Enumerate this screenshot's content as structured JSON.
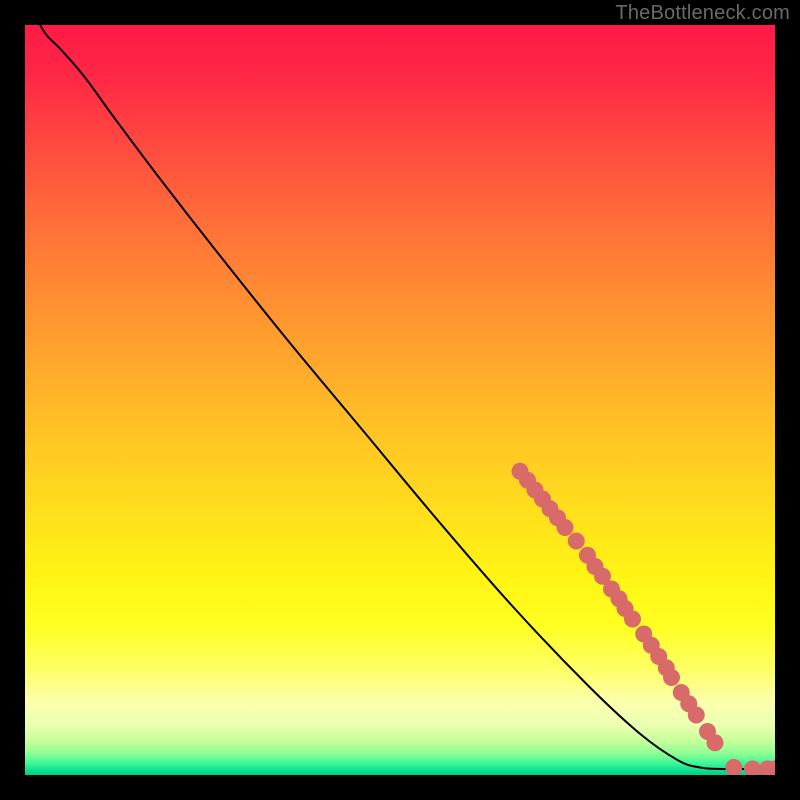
{
  "watermark": "TheBottleneck.com",
  "colors": {
    "marker_fill": "#d86a6a",
    "curve_stroke": "#000000"
  },
  "chart_data": {
    "type": "line",
    "title": "",
    "xlabel": "",
    "ylabel": "",
    "xlim": [
      0,
      100
    ],
    "ylim": [
      0,
      100
    ],
    "curve": [
      {
        "x": 2.0,
        "y": 100.0
      },
      {
        "x": 3.0,
        "y": 98.5
      },
      {
        "x": 5.0,
        "y": 96.5
      },
      {
        "x": 8.0,
        "y": 93.0
      },
      {
        "x": 12.0,
        "y": 87.5
      },
      {
        "x": 18.0,
        "y": 79.5
      },
      {
        "x": 25.0,
        "y": 70.5
      },
      {
        "x": 35.0,
        "y": 58.0
      },
      {
        "x": 45.0,
        "y": 46.0
      },
      {
        "x": 55.0,
        "y": 34.0
      },
      {
        "x": 65.0,
        "y": 22.5
      },
      {
        "x": 75.0,
        "y": 12.0
      },
      {
        "x": 82.0,
        "y": 5.5
      },
      {
        "x": 87.0,
        "y": 2.0
      },
      {
        "x": 90.0,
        "y": 1.0
      },
      {
        "x": 93.0,
        "y": 0.8
      },
      {
        "x": 97.0,
        "y": 0.8
      },
      {
        "x": 100.0,
        "y": 0.8
      }
    ],
    "markers": [
      {
        "x": 66.0,
        "y": 40.5
      },
      {
        "x": 67.0,
        "y": 39.3
      },
      {
        "x": 68.0,
        "y": 38.0
      },
      {
        "x": 69.0,
        "y": 36.8
      },
      {
        "x": 70.0,
        "y": 35.5
      },
      {
        "x": 71.0,
        "y": 34.3
      },
      {
        "x": 72.0,
        "y": 33.0
      },
      {
        "x": 73.5,
        "y": 31.2
      },
      {
        "x": 75.0,
        "y": 29.3
      },
      {
        "x": 76.0,
        "y": 27.8
      },
      {
        "x": 77.0,
        "y": 26.5
      },
      {
        "x": 78.2,
        "y": 24.8
      },
      {
        "x": 79.2,
        "y": 23.5
      },
      {
        "x": 80.0,
        "y": 22.2
      },
      {
        "x": 81.0,
        "y": 20.8
      },
      {
        "x": 82.5,
        "y": 18.8
      },
      {
        "x": 83.5,
        "y": 17.3
      },
      {
        "x": 84.5,
        "y": 15.8
      },
      {
        "x": 85.5,
        "y": 14.3
      },
      {
        "x": 86.2,
        "y": 13.0
      },
      {
        "x": 87.5,
        "y": 11.0
      },
      {
        "x": 88.5,
        "y": 9.5
      },
      {
        "x": 89.5,
        "y": 8.0
      },
      {
        "x": 91.0,
        "y": 5.8
      },
      {
        "x": 92.0,
        "y": 4.3
      },
      {
        "x": 94.5,
        "y": 1.0
      },
      {
        "x": 97.0,
        "y": 0.8
      },
      {
        "x": 99.0,
        "y": 0.8
      },
      {
        "x": 100.0,
        "y": 0.8
      }
    ],
    "gradient_stops": [
      {
        "offset": 0.0,
        "color": "#ff1a47"
      },
      {
        "offset": 0.07,
        "color": "#ff2845"
      },
      {
        "offset": 0.15,
        "color": "#ff4640"
      },
      {
        "offset": 0.25,
        "color": "#ff6a3a"
      },
      {
        "offset": 0.35,
        "color": "#ff8a33"
      },
      {
        "offset": 0.45,
        "color": "#ffa82c"
      },
      {
        "offset": 0.55,
        "color": "#ffc524"
      },
      {
        "offset": 0.65,
        "color": "#ffdf1c"
      },
      {
        "offset": 0.73,
        "color": "#fff314"
      },
      {
        "offset": 0.8,
        "color": "#ffff20"
      },
      {
        "offset": 0.86,
        "color": "#feff66"
      },
      {
        "offset": 0.905,
        "color": "#fbffb0"
      },
      {
        "offset": 0.935,
        "color": "#eaffb0"
      },
      {
        "offset": 0.955,
        "color": "#c4ff9a"
      },
      {
        "offset": 0.972,
        "color": "#8aff94"
      },
      {
        "offset": 0.985,
        "color": "#3af597"
      },
      {
        "offset": 0.995,
        "color": "#06dd8f"
      },
      {
        "offset": 1.0,
        "color": "#00cf86"
      }
    ]
  }
}
